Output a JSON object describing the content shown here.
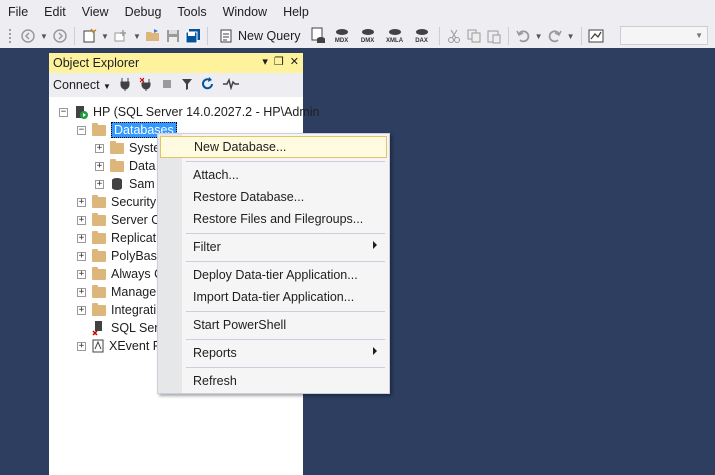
{
  "menubar": {
    "items": [
      "File",
      "Edit",
      "View",
      "Debug",
      "Tools",
      "Window",
      "Help"
    ]
  },
  "toolbar": {
    "new_query_label": "New Query",
    "query_buttons": [
      "MDX",
      "DMX",
      "XMLA",
      "DAX"
    ]
  },
  "object_explorer": {
    "title": "Object Explorer",
    "connect_label": "Connect",
    "server_node": "HP (SQL Server 14.0.2027.2 - HP\\Admin",
    "databases_label": "Databases",
    "db_children": [
      "Syster",
      "Data",
      "Sam"
    ],
    "nodes": [
      "Security",
      "Server O",
      "Replicat",
      "PolyBase",
      "Always O",
      "Manage",
      "Integrati",
      "SQL Serv",
      "XEvent P"
    ]
  },
  "context_menu": {
    "new_database": "New Database...",
    "attach": "Attach...",
    "restore_database": "Restore Database...",
    "restore_files": "Restore Files and Filegroups...",
    "filter": "Filter",
    "deploy": "Deploy Data-tier Application...",
    "import": "Import Data-tier Application...",
    "powershell": "Start PowerShell",
    "reports": "Reports",
    "refresh": "Refresh"
  }
}
